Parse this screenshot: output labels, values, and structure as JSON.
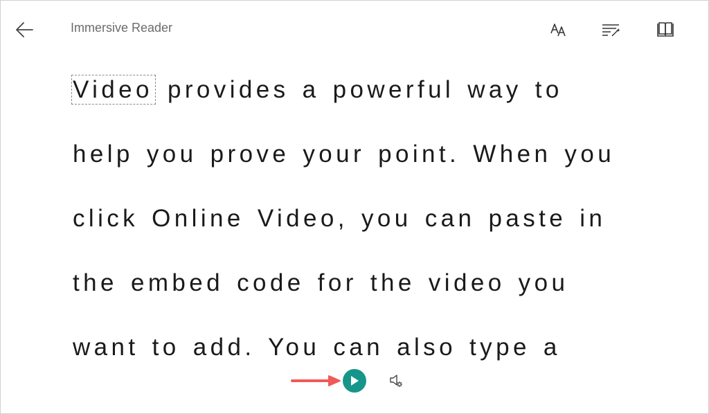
{
  "header": {
    "title": "Immersive Reader",
    "back_icon": "arrow-left-icon",
    "text_prefs_icon": "text-size-icon",
    "grammar_icon": "grammar-options-icon",
    "reading_prefs_icon": "book-icon"
  },
  "content": {
    "lines": [
      {
        "focus_word": "Video",
        "rest": " provides a powerful way to"
      },
      {
        "text": "help you prove your point. When you"
      },
      {
        "text": "click Online Video, you can paste in"
      },
      {
        "text": "the embed code for the video you"
      },
      {
        "text": "want to add. You can also type a"
      }
    ]
  },
  "playback": {
    "play_icon": "play-icon",
    "voice_settings_icon": "voice-settings-icon",
    "annotation_icon": "red-arrow-icon",
    "play_color": "#16968a",
    "arrow_color": "#f05a57"
  }
}
